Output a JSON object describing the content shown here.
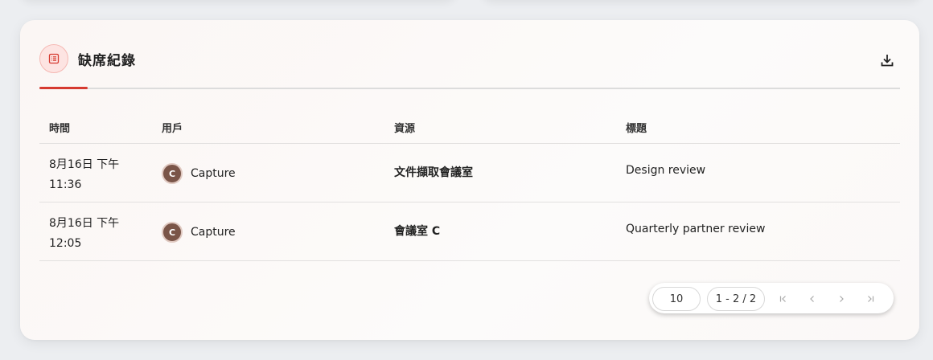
{
  "panel": {
    "title": "缺席紀錄"
  },
  "table": {
    "headers": [
      "時間",
      "用戶",
      "資源",
      "標題"
    ],
    "rows": [
      {
        "date": "8月16日 下午",
        "time": "11:36",
        "user_initial": "C",
        "user": "Capture",
        "resource": "文件擷取會議室",
        "title": "Design review"
      },
      {
        "date": "8月16日 下午",
        "time": "12:05",
        "user_initial": "C",
        "user": "Capture",
        "resource": "會議室 C",
        "title": "Quarterly partner review"
      }
    ]
  },
  "pagination": {
    "page_size": "10",
    "range": "1 - 2 / 2"
  },
  "colors": {
    "accent": "#d63a30",
    "avatar": "#7a5548"
  }
}
